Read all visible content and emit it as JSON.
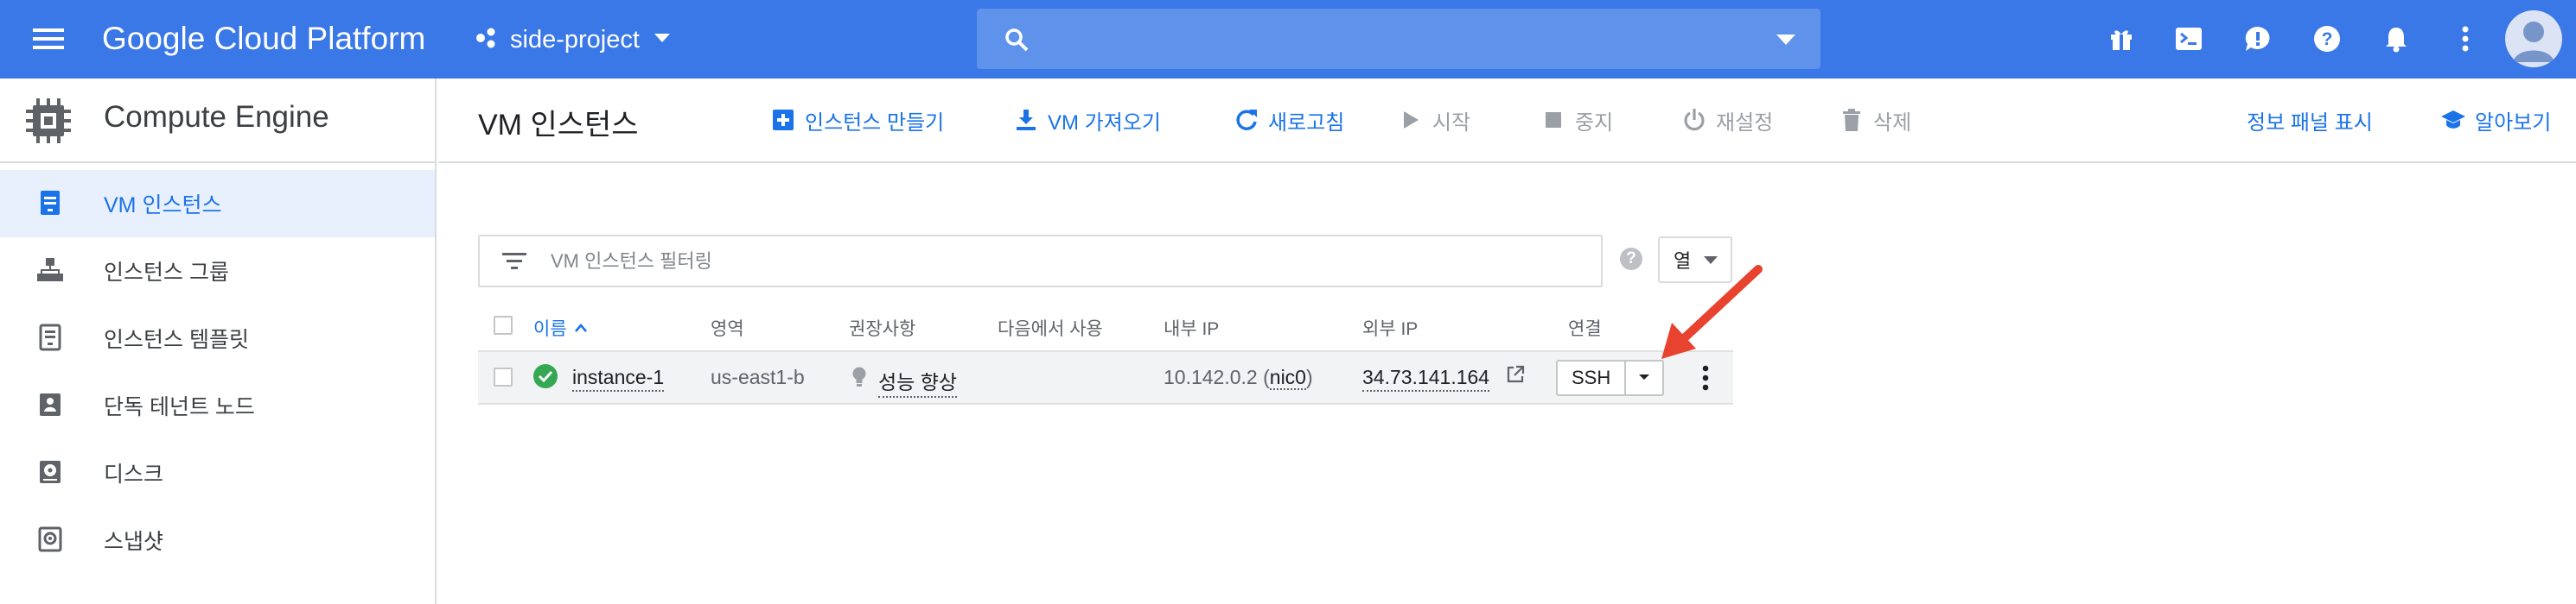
{
  "topbar": {
    "brand": "Google Cloud Platform",
    "project": "side-project",
    "search_placeholder": "",
    "background": "#3b78e7",
    "icons": [
      "menu-icon",
      "gift-icon",
      "cloud-shell-icon",
      "feedback-icon",
      "help-icon",
      "notifications-icon",
      "more-vert-icon",
      "account-icon"
    ]
  },
  "sidebar": {
    "title": "Compute Engine",
    "items": [
      {
        "label": "VM 인스턴스",
        "icon": "vm-instance-icon",
        "active": true
      },
      {
        "label": "인스턴스 그룹",
        "icon": "instance-group-icon",
        "active": false
      },
      {
        "label": "인스턴스 템플릿",
        "icon": "instance-template-icon",
        "active": false
      },
      {
        "label": "단독 테넌트 노드",
        "icon": "sole-tenant-icon",
        "active": false
      },
      {
        "label": "디스크",
        "icon": "disk-icon",
        "active": false
      },
      {
        "label": "스냅샷",
        "icon": "snapshot-icon",
        "active": false
      }
    ]
  },
  "toolbar": {
    "page_title": "VM 인스턴스",
    "create": "인스턴스 만들기",
    "import_vm": "VM 가져오기",
    "refresh": "새로고침",
    "start": "시작",
    "stop": "중지",
    "reset": "재설정",
    "delete": "삭제",
    "show_info_panel": "정보 패널 표시",
    "learn": "알아보기"
  },
  "filter": {
    "placeholder": "VM 인스턴스 필터링",
    "columns_button": "열"
  },
  "table": {
    "headers": {
      "name": "이름",
      "zone": "영역",
      "recommendation": "권장사항",
      "in_use_by": "다음에서 사용",
      "internal_ip": "내부 IP",
      "external_ip": "외부 IP",
      "connect": "연결"
    },
    "rows": [
      {
        "status": "running",
        "name": "instance-1",
        "zone": "us-east1-b",
        "recommendation": "성능 향상",
        "in_use_by": "",
        "internal_ip": "10.142.0.2",
        "internal_nic": "nic0",
        "external_ip": "34.73.141.164",
        "connect": "SSH"
      }
    ]
  },
  "colors": {
    "accent": "#1a73e8",
    "status_ok": "#34a853",
    "annotation_arrow": "#e8432e"
  }
}
